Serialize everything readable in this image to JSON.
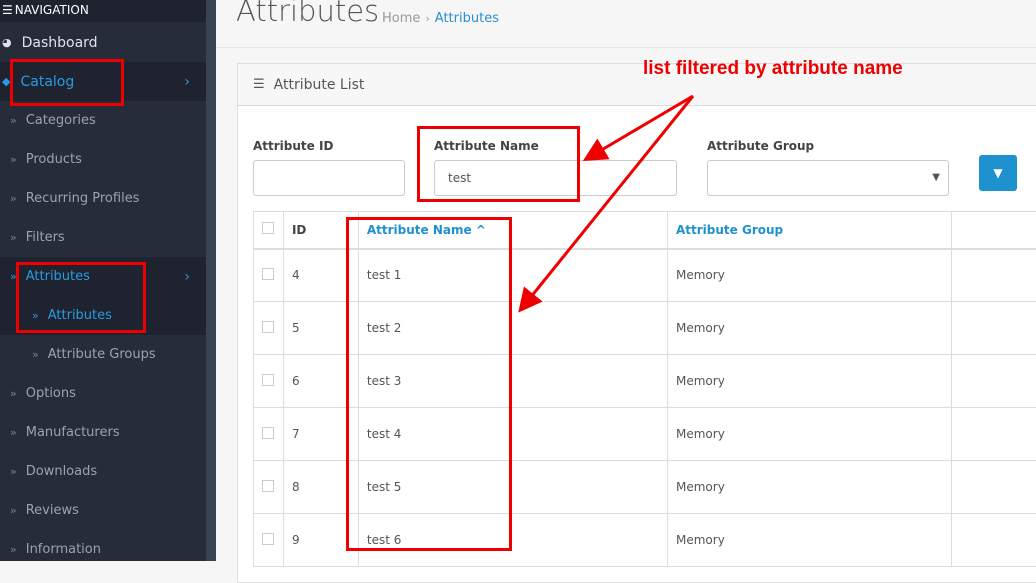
{
  "sidebar": {
    "nav_heading": "NAVIGATION",
    "items": [
      {
        "label": "Dashboard",
        "icon": "dashboard-icon"
      },
      {
        "label": "Catalog",
        "icon": "tag-icon"
      },
      {
        "label": "Categories"
      },
      {
        "label": "Products"
      },
      {
        "label": "Recurring Profiles"
      },
      {
        "label": "Filters"
      },
      {
        "label": "Attributes"
      },
      {
        "label": "Attributes"
      },
      {
        "label": "Attribute Groups"
      },
      {
        "label": "Options"
      },
      {
        "label": "Manufacturers"
      },
      {
        "label": "Downloads"
      },
      {
        "label": "Reviews"
      },
      {
        "label": "Information"
      }
    ]
  },
  "header": {
    "title": "Attributes",
    "breadcrumb": [
      "Home",
      "Attributes"
    ]
  },
  "panel": {
    "title": "Attribute List"
  },
  "filters": {
    "id_label": "Attribute ID",
    "id_value": "",
    "name_label": "Attribute Name",
    "name_value": "test",
    "group_label": "Attribute Group",
    "group_value": ""
  },
  "table": {
    "columns": [
      "ID",
      "Attribute Name",
      "Attribute Group"
    ],
    "sort_indicator": "^",
    "rows": [
      {
        "id": "4",
        "name": "test 1",
        "group": "Memory"
      },
      {
        "id": "5",
        "name": "test 2",
        "group": "Memory"
      },
      {
        "id": "6",
        "name": "test 3",
        "group": "Memory"
      },
      {
        "id": "7",
        "name": "test 4",
        "group": "Memory"
      },
      {
        "id": "8",
        "name": "test 5",
        "group": "Memory"
      },
      {
        "id": "9",
        "name": "test 6",
        "group": "Memory"
      }
    ]
  },
  "annotation": {
    "text": "list filtered by attribute name",
    "color": "#ee0000"
  },
  "colors": {
    "accent": "#1e91cf",
    "sidebar": "#262c3a"
  }
}
